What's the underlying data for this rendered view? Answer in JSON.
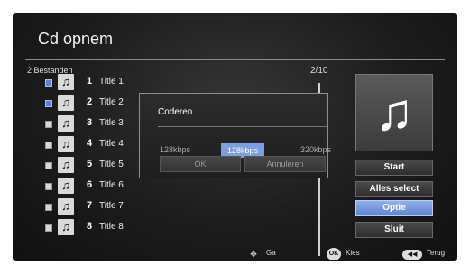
{
  "header": {
    "title": "Cd opnem"
  },
  "list": {
    "count_label": "2 Bestanden",
    "pager": "2/10",
    "items": [
      {
        "number": "1",
        "title": "Title 1",
        "checked": true
      },
      {
        "number": "2",
        "title": "Title 2",
        "checked": true
      },
      {
        "number": "3",
        "title": "Title 3",
        "checked": false
      },
      {
        "number": "4",
        "title": "Title 4",
        "checked": false
      },
      {
        "number": "5",
        "title": "Title 5",
        "checked": false
      },
      {
        "number": "6",
        "title": "Title 6",
        "checked": false
      },
      {
        "number": "7",
        "title": "Title 7",
        "checked": false
      },
      {
        "number": "8",
        "title": "Title 8",
        "checked": false
      }
    ]
  },
  "dialog": {
    "title": "Coderen",
    "options": [
      "128kbps",
      "128kbps",
      "320kbps"
    ],
    "selected_index": 1,
    "ok_label": "OK",
    "cancel_label": "Annuleren"
  },
  "side_menu": {
    "items": [
      {
        "label": "Start",
        "active": false
      },
      {
        "label": "Alles select",
        "active": false
      },
      {
        "label": "Optie",
        "active": true
      },
      {
        "label": "Sluit",
        "active": false
      }
    ]
  },
  "footer": {
    "nav_label": "Ga",
    "ok_badge": "OK",
    "ok_label": "Kies",
    "back_label": "Terug"
  },
  "icons": {
    "checkbox": "checkbox-icon",
    "music_note": "music-note-icon",
    "nav": "directional-pad-icon",
    "ok": "ok-button-icon",
    "back": "back-button-icon"
  },
  "colors": {
    "selected": "#7d9fe0",
    "checked": "#5b7fd6"
  }
}
